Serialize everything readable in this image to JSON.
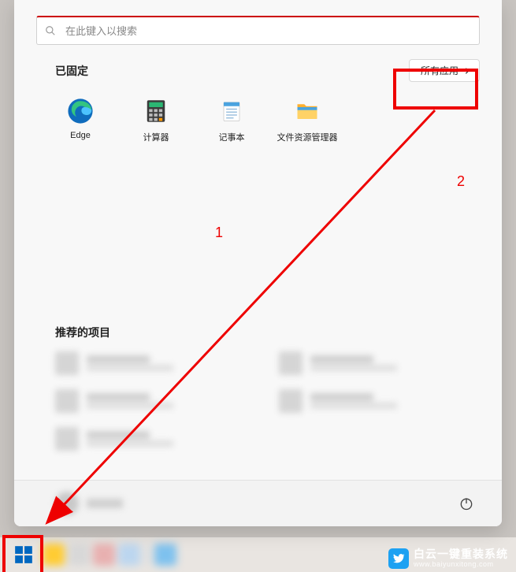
{
  "search": {
    "placeholder": "在此键入以搜索"
  },
  "pinned": {
    "title": "已固定",
    "all_apps_label": "所有应用",
    "items": [
      {
        "label": "Edge",
        "icon": "edge"
      },
      {
        "label": "计算器",
        "icon": "calculator"
      },
      {
        "label": "记事本",
        "icon": "notepad"
      },
      {
        "label": "文件资源管理器",
        "icon": "file-explorer"
      }
    ]
  },
  "recommended": {
    "title": "推荐的项目"
  },
  "annotations": {
    "label1": "1",
    "label2": "2"
  },
  "watermark": {
    "line1": "白云一键重装系统",
    "line2": "www.baiyunxitong.com"
  }
}
